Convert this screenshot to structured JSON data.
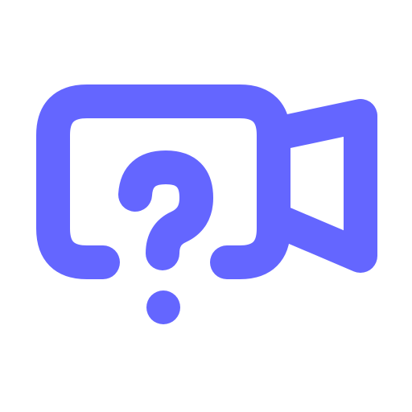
{
  "icon": {
    "name": "video-camera-question-icon",
    "color": "#6466FF",
    "background": "#FFFFFF"
  }
}
